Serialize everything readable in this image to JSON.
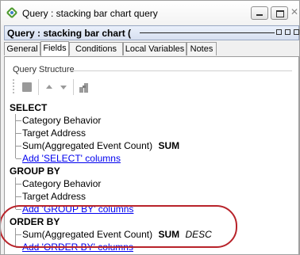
{
  "window": {
    "title": "Query : stacking bar chart query",
    "close_symbol": "✕"
  },
  "inner": {
    "title": "Query : stacking bar chart ("
  },
  "tabs": [
    {
      "label": "General"
    },
    {
      "label": "Fields"
    },
    {
      "label": "Conditions"
    },
    {
      "label": "Local Variables"
    },
    {
      "label": "Notes"
    }
  ],
  "structure": {
    "group_label": "Query Structure",
    "select": {
      "heading": "SELECT",
      "items": [
        "Category Behavior",
        "Target Address",
        "Sum(Aggregated Event Count)"
      ],
      "sum_suffix": "SUM",
      "add_link": "Add 'SELECT' columns"
    },
    "group_by": {
      "heading": "GROUP BY",
      "items": [
        "Category Behavior",
        "Target Address"
      ],
      "add_link": "Add 'GROUP BY' columns"
    },
    "order_by": {
      "heading": "ORDER BY",
      "item": "Sum(Aggregated Event Count)",
      "sum_suffix": "SUM",
      "direction": "DESC",
      "add_link": "Add 'ORDER BY' columns"
    }
  },
  "colors": {
    "accent_link": "#0000ee",
    "highlight_oval": "#b8232a"
  }
}
